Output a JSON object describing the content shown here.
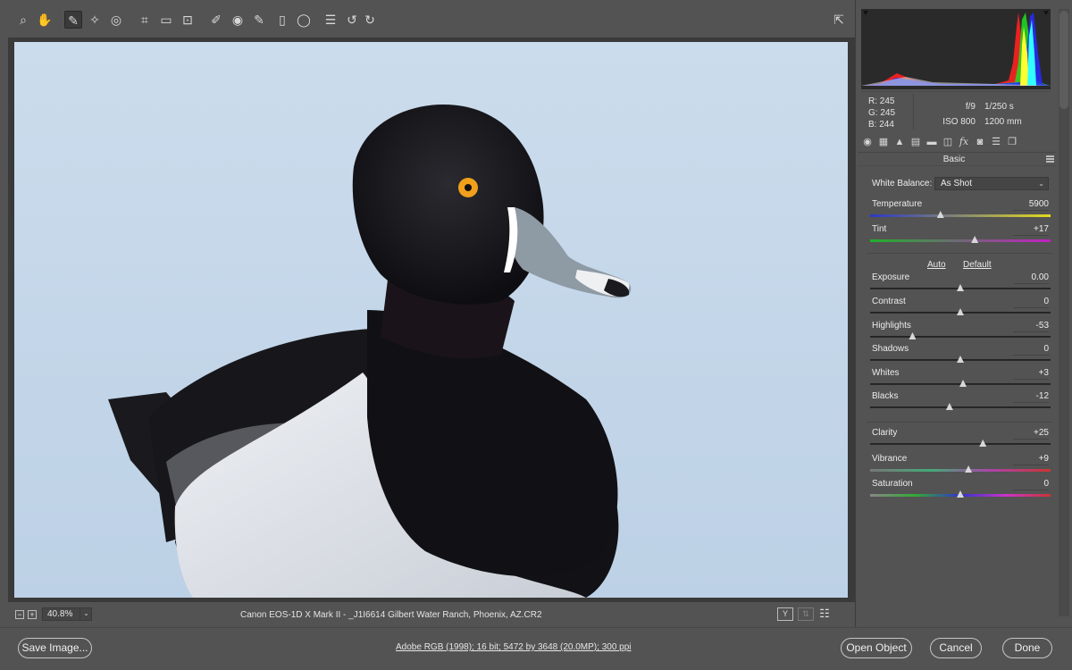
{
  "toolbar": {
    "tools": [
      {
        "icon": "zoom-icon",
        "glyph": "⌕"
      },
      {
        "icon": "hand-icon",
        "glyph": "✋"
      },
      {
        "icon": "white-balance-eyedropper-icon",
        "glyph": "✎"
      },
      {
        "icon": "color-sampler-icon",
        "glyph": "✧"
      },
      {
        "icon": "targeted-adjustment-icon",
        "glyph": "◎"
      },
      {
        "icon": "crop-icon",
        "glyph": "⌗"
      },
      {
        "icon": "straighten-icon",
        "glyph": "▭"
      },
      {
        "icon": "transform-icon",
        "glyph": "⊡"
      },
      {
        "icon": "spot-removal-icon",
        "glyph": "✐"
      },
      {
        "icon": "red-eye-icon",
        "glyph": "◉"
      },
      {
        "icon": "adjustment-brush-icon",
        "glyph": "✎"
      },
      {
        "icon": "graduated-filter-icon",
        "glyph": "▯"
      },
      {
        "icon": "radial-filter-icon",
        "glyph": "◯"
      },
      {
        "icon": "preferences-icon",
        "glyph": "☰"
      },
      {
        "icon": "rotate-left-icon",
        "glyph": "↺"
      },
      {
        "icon": "rotate-right-icon",
        "glyph": "↻"
      }
    ],
    "active_tool": "white-balance-eyedropper-icon",
    "fullscreen_icon": "⇱"
  },
  "status": {
    "zoom_value": "40.8%",
    "file_info": "Canon EOS-1D X Mark II  -  _J1I6614  Gilbert Water Ranch, Phoenix, AZ.CR2",
    "before_after_label": "Y"
  },
  "readout": {
    "r": "R:  245",
    "g": "G:  245",
    "b": "B:  244",
    "aperture": "f/9",
    "shutter": "1/250 s",
    "iso": "ISO 800",
    "focal": "1200 mm"
  },
  "panel": {
    "title": "Basic",
    "wb_label": "White Balance:",
    "wb_value": "As Shot",
    "auto": "Auto",
    "default": "Default",
    "sliders": [
      {
        "label": "Temperature",
        "value": "5900",
        "position": 0.39,
        "gradient": "linear-gradient(90deg,#2b39c4,#e1d91e)"
      },
      {
        "label": "Tint",
        "value": "+17",
        "position": 0.58,
        "gradient": "linear-gradient(90deg,#1fb02b,#c220c2)"
      },
      {
        "label": "Exposure",
        "value": "0.00",
        "position": 0.5,
        "gradient": ""
      },
      {
        "label": "Contrast",
        "value": "0",
        "position": 0.5,
        "gradient": ""
      },
      {
        "label": "Highlights",
        "value": "-53",
        "position": 0.235,
        "gradient": ""
      },
      {
        "label": "Shadows",
        "value": "0",
        "position": 0.5,
        "gradient": ""
      },
      {
        "label": "Whites",
        "value": "+3",
        "position": 0.515,
        "gradient": ""
      },
      {
        "label": "Blacks",
        "value": "-12",
        "position": 0.44,
        "gradient": ""
      },
      {
        "label": "Clarity",
        "value": "+25",
        "position": 0.625,
        "gradient": ""
      },
      {
        "label": "Vibrance",
        "value": "+9",
        "position": 0.545,
        "gradient": "linear-gradient(90deg,#777,#4a7,#a4a,#c33)"
      },
      {
        "label": "Saturation",
        "value": "0",
        "position": 0.5,
        "gradient": "linear-gradient(90deg,#888,#3a3,#33c,#c3c,#c33)"
      }
    ]
  },
  "footer": {
    "save_label": "Save Image...",
    "workflow": "Adobe RGB (1998); 16 bit; 5472 by 3648 (20.0MP); 300 ppi",
    "open_label": "Open Object",
    "cancel_label": "Cancel",
    "done_label": "Done"
  },
  "colors": {
    "panel_bg": "#535353",
    "canvas_bg": "#3a3a3a",
    "photo_sky": "#c7d8ea"
  }
}
